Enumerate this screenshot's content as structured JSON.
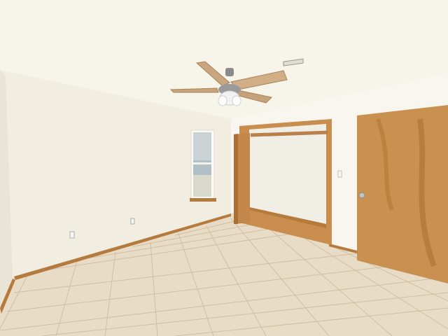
{
  "scene": {
    "description_free": true,
    "colors": {
      "ceiling": "#f7f4ea",
      "left_wall": "#f4efe3",
      "back_wall": "#f3efe5",
      "right_wall": "#f8f6ee",
      "floor_tile": "#e8dac3",
      "grout": "#cdbb9f",
      "wood_door": "#c89456",
      "baseboard": "#b57a3e",
      "fan_blade": "#c9a580",
      "fan_metal": "#8a8a8a",
      "window_glass": "#aebcc6"
    },
    "objects": {
      "ceiling_fan": "ceiling-fan",
      "window": "window",
      "closet_door_open": "closet-door",
      "room_door": "room-door",
      "tile_floor": "tile-floor",
      "air_vent": "air-vent",
      "outlet": "outlet"
    }
  }
}
